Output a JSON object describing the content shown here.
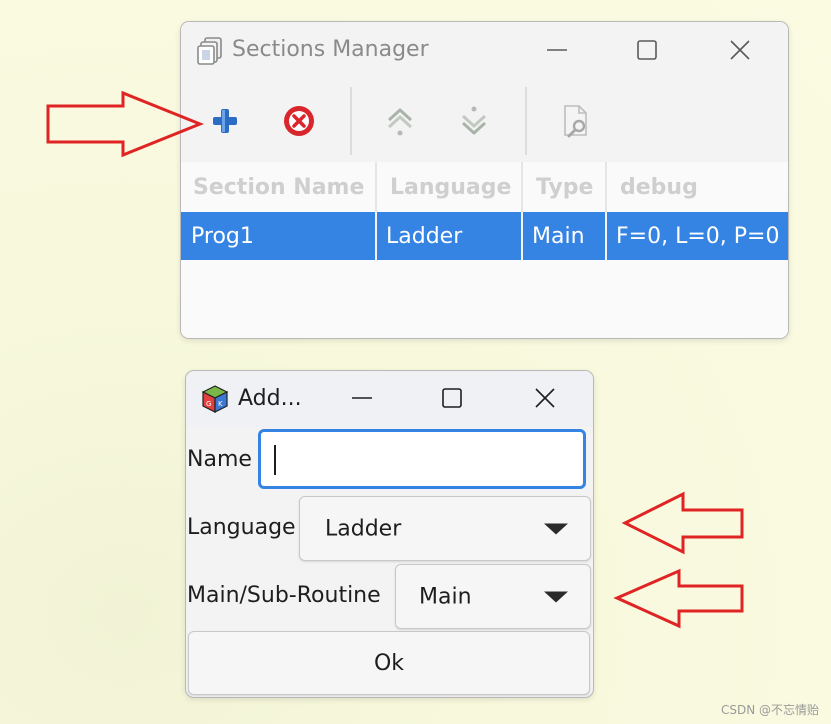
{
  "sections_manager": {
    "title": "Sections Manager",
    "toolbar": {
      "add_icon": "plus-icon",
      "remove_icon": "close-circle-icon",
      "move_up_icon": "arrow-up-icon",
      "move_down_icon": "arrow-down-icon",
      "properties_icon": "document-wrench-icon"
    },
    "columns": [
      "Section Name",
      "Language",
      "Type",
      "debug"
    ],
    "rows": [
      {
        "name": "Prog1",
        "language": "Ladder",
        "type": "Main",
        "debug": "F=0, L=0, P=0",
        "selected": true
      }
    ]
  },
  "add_dialog": {
    "title": "Add...",
    "name_label": "Name",
    "name_value": "",
    "language_label": "Language",
    "language_value": "Ladder",
    "routine_label": "Main/Sub-Routine",
    "routine_value": "Main",
    "ok_label": "Ok"
  },
  "annotations": {
    "arrow_color": "#e02424",
    "arrows": [
      "pointing-at-add-button",
      "pointing-at-language-combo",
      "pointing-at-routine-combo"
    ]
  },
  "watermark": "CSDN @不忘情贻",
  "colors": {
    "selection": "#3584e4",
    "focus_border": "#3584e4",
    "add_icon": "#2b6cc4",
    "remove_icon": "#d9262c"
  }
}
